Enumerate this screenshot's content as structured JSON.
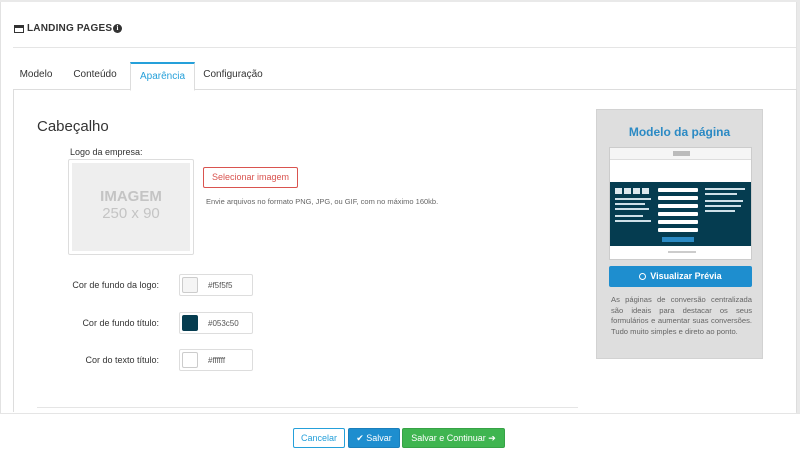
{
  "header": {
    "title": "LANDING PAGES",
    "icon": "window-icon",
    "info_icon": "info-circle-icon",
    "info_glyph": "i"
  },
  "tabs": [
    {
      "label": "Modelo",
      "active": false
    },
    {
      "label": "Conteúdo",
      "active": false
    },
    {
      "label": "Aparência",
      "active": true
    },
    {
      "label": "Configuração",
      "active": false
    }
  ],
  "section": {
    "title": "Cabeçalho",
    "logo": {
      "label": "Logo da empresa:",
      "placeholder_line1": "IMAGEM",
      "placeholder_line2": "250 x 90",
      "select_button": "Selecionar imagem",
      "help": "Envie arquivos no formato PNG, JPG, ou GIF, com no máximo 160kb."
    },
    "colors": [
      {
        "label": "Cor de fundo da logo:",
        "value": "#f5f5f5"
      },
      {
        "label": "Cor de fundo título:",
        "value": "#053c50"
      },
      {
        "label": "Cor do texto título:",
        "value": "#ffffff"
      }
    ]
  },
  "preview": {
    "title": "Modelo da página",
    "button": "Visualizar Prévia",
    "button_icon": "search-icon",
    "description": "As páginas de conversão centralizada são ideais para destacar os seus formulários e aumentar suas conversões. Tudo muito simples e direto ao ponto."
  },
  "footer": {
    "cancel": "Cancelar",
    "save": "Salvar",
    "save_check": "✔",
    "save_continue": "Salvar e Continuar",
    "save_continue_arrow": "➔"
  },
  "accent_colors": {
    "primary": "#1e8ecf",
    "success": "#3fb550",
    "danger": "#d9534f",
    "title_bg": "#053c50"
  }
}
